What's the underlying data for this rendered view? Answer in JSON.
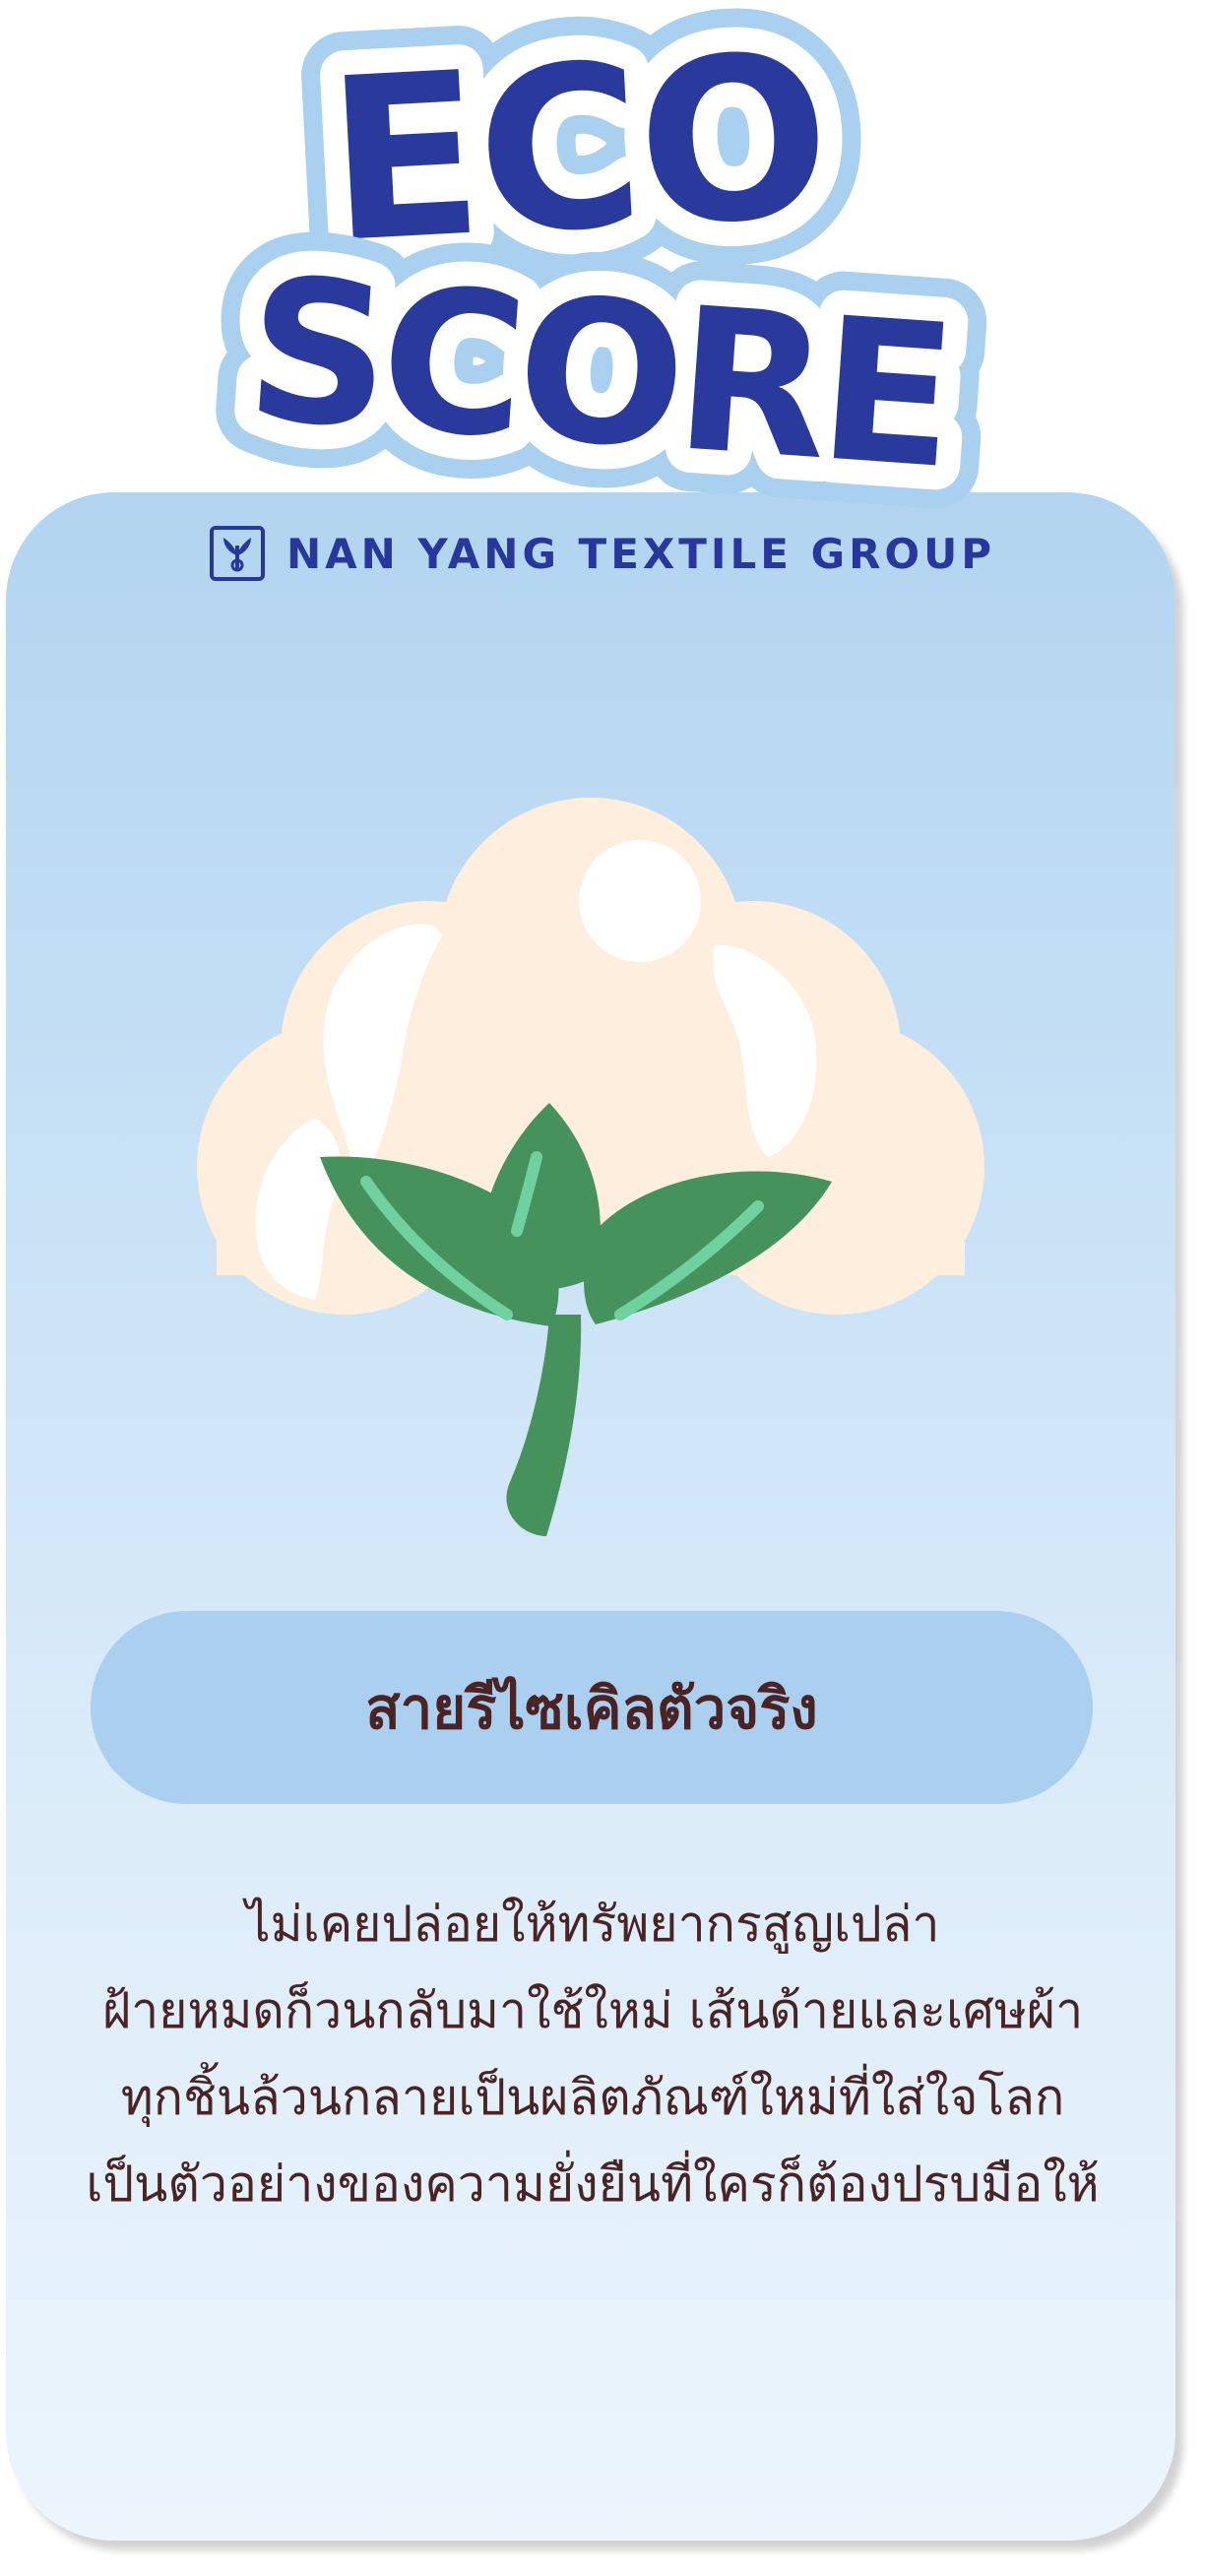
{
  "title": {
    "line1": "ECO",
    "line2": "SCORE"
  },
  "brand": {
    "name": "NAN YANG TEXTILE GROUP",
    "logo_icon": "nan-yang-logo-icon"
  },
  "illustration": {
    "icon": "cotton-boll-icon"
  },
  "headline": "สายรีไซเคิลตัวจริง",
  "description": [
    "ไม่เคยปล่อยให้ทรัพยากรสูญเปล่า",
    "ฝ้ายหมดก็วนกลับมาใช้ใหม่ เส้นด้ายและเศษผ้า",
    "ทุกชิ้นล้วนกลายเป็นผลิตภัณฑ์ใหม่ที่ใส่ใจโลก",
    "เป็นตัวอย่างของความยั่งยืนที่ใครก็ต้องปรบมือให้"
  ],
  "colors": {
    "title_blue": "#2a3a9c",
    "title_outline_light": "#a9d0ef",
    "card_top": "#b2d4f0",
    "card_bottom": "#ecf5fc",
    "pill": "#abcfee",
    "text_brown": "#4a2424",
    "leaf_green": "#46925c",
    "cotton_cream": "#fdeedd"
  }
}
